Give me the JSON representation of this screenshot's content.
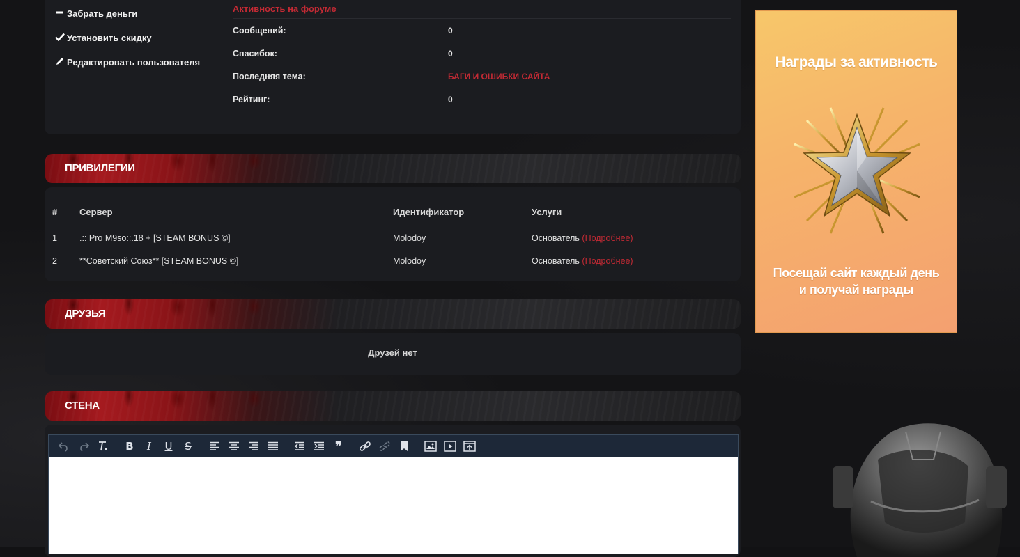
{
  "profile_actions": [
    {
      "label": "Забрать деньги",
      "icon": "minus-icon"
    },
    {
      "label": "Установить скидку",
      "icon": "check-icon"
    },
    {
      "label": "Редактировать пользователя",
      "icon": "pencil-icon"
    }
  ],
  "forum_activity": {
    "title": "Активность на форуме",
    "rows": [
      {
        "label": "Сообщений:",
        "value": "0"
      },
      {
        "label": "Спасибок:",
        "value": "0"
      },
      {
        "label": "Последняя тема:",
        "value": "БАГИ И ОШИБКИ САЙТА"
      },
      {
        "label": "Рейтинг:",
        "value": "0"
      }
    ]
  },
  "privileges": {
    "title": "ПРИВИЛЕГИИ",
    "headers": [
      "#",
      "Сервер",
      "Идентификатор",
      "Услуги"
    ],
    "rows": [
      {
        "num": "1",
        "server": ".:: Pro M9so::.18 + [STEAM BONUS ©]",
        "identifier": "Molodoy",
        "service": "Основатель",
        "more": "(Подробнее)"
      },
      {
        "num": "2",
        "server": "**Советский Союз** [STEAM BONUS ©]",
        "identifier": "Molodoy",
        "service": "Основатель",
        "more": "(Подробнее)"
      }
    ]
  },
  "friends": {
    "title": "ДРУЗЬЯ",
    "empty_text": "Друзей нет"
  },
  "wall": {
    "title": "СТЕНА",
    "toolbar": [
      "undo-icon",
      "redo-icon",
      "clear-format-icon",
      "bold-icon",
      "italic-icon",
      "underline-icon",
      "strikethrough-icon",
      "align-left-icon",
      "align-center-icon",
      "align-right-icon",
      "align-justify-icon",
      "outdent-icon",
      "indent-icon",
      "quote-icon",
      "link-icon",
      "unlink-icon",
      "bookmark-icon",
      "image-icon",
      "video-icon",
      "upload-icon"
    ]
  },
  "banner": {
    "title": "Награды за активность",
    "subtitle": "Посещай сайт каждый день и получай награды"
  },
  "colors": {
    "accent_red": "#c32a34",
    "panel_bg": "#1b1c20",
    "banner_orange": "#f6b46a",
    "toolbar_bg": "#1d2838"
  }
}
